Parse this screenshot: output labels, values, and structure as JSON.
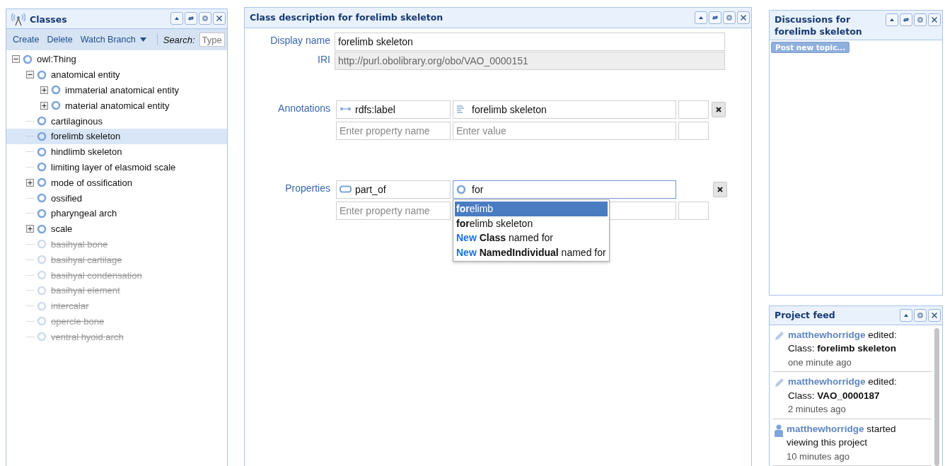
{
  "classes_panel": {
    "title": "Classes",
    "toolbar": {
      "actions": [
        "Create",
        "Delete",
        "Watch Branch"
      ],
      "search_label": "Search:",
      "search_placeholder": "Type"
    },
    "tree": [
      {
        "label": "owl:Thing",
        "expanded": true,
        "selected": false,
        "deprecated": false,
        "children": [
          {
            "label": "anatomical entity",
            "expanded": true,
            "selected": false,
            "deprecated": false,
            "children": [
              {
                "label": "immaterial anatomical entity",
                "expanded": false,
                "selected": false,
                "deprecated": false
              },
              {
                "label": "material anatomical entity",
                "expanded": false,
                "selected": false,
                "deprecated": false
              }
            ]
          },
          {
            "label": "cartilaginous",
            "selected": false,
            "deprecated": false
          },
          {
            "label": "forelimb skeleton",
            "selected": true,
            "deprecated": false
          },
          {
            "label": "hindlimb skeleton",
            "selected": false,
            "deprecated": false
          },
          {
            "label": "limiting layer of elasmoid scale",
            "selected": false,
            "deprecated": false
          },
          {
            "label": "mode of ossification",
            "expanded": false,
            "selected": false,
            "deprecated": false
          },
          {
            "label": "ossified",
            "selected": false,
            "deprecated": false
          },
          {
            "label": "pharyngeal arch",
            "selected": false,
            "deprecated": false
          },
          {
            "label": "scale",
            "expanded": false,
            "selected": false,
            "deprecated": false
          },
          {
            "label": "basihyal bone",
            "selected": false,
            "deprecated": true
          },
          {
            "label": "basihyal cartilage",
            "selected": false,
            "deprecated": true
          },
          {
            "label": "basihyal condensation",
            "selected": false,
            "deprecated": true
          },
          {
            "label": "basihyal element",
            "selected": false,
            "deprecated": true
          },
          {
            "label": "intercalar",
            "selected": false,
            "deprecated": true
          },
          {
            "label": "opercle bone",
            "selected": false,
            "deprecated": true
          },
          {
            "label": "ventral hyoid arch",
            "selected": false,
            "deprecated": true
          }
        ]
      }
    ]
  },
  "description_panel": {
    "title": "Class description for forelimb skeleton",
    "display_name": {
      "label": "Display name",
      "value": "forelimb skeleton"
    },
    "iri": {
      "label": "IRI",
      "value": "http://purl.obolibrary.org/obo/VAO_0000151"
    },
    "annotations": {
      "label": "Annotations",
      "rows": [
        {
          "property": {
            "kind": "annotation_property",
            "value": "rdfs:label"
          },
          "value": {
            "kind": "literal",
            "value": "forelimb skeleton"
          },
          "removable": true
        },
        {
          "property": {
            "placeholder": "Enter property name"
          },
          "value": {
            "placeholder": "Enter value"
          },
          "removable": false
        }
      ]
    },
    "properties": {
      "label": "Properties",
      "rows": [
        {
          "property": {
            "kind": "object_property",
            "value": "part_of"
          },
          "value": {
            "kind": "class",
            "value": "for",
            "focused": true
          },
          "removable": true
        },
        {
          "property": {
            "placeholder": "Enter property name"
          },
          "value": {},
          "removable": false
        }
      ],
      "suggestions": [
        {
          "kind": "match",
          "text": "**for**elimb",
          "selected": true
        },
        {
          "kind": "match",
          "text": "**for**elimb skeleton",
          "selected": false
        },
        {
          "kind": "new",
          "prefix": "New",
          "text": "**Class** named for",
          "selected": false
        },
        {
          "kind": "new",
          "prefix": "New",
          "text": "**NamedIndividual** named for",
          "selected": false
        }
      ]
    }
  },
  "discussions_panel": {
    "title": "Discussions for forelimb skeleton",
    "button": "Post new topic..."
  },
  "feed_panel": {
    "title": "Project feed",
    "items": [
      {
        "kind": "edit",
        "user": "matthewhorridge",
        "action": "edited:",
        "detail": "Class: **forelimb skeleton**",
        "time": "one minute ago"
      },
      {
        "kind": "edit",
        "user": "matthewhorridge",
        "action": "edited:",
        "detail": "Class: **VAO_0000187**",
        "time": "2 minutes ago"
      },
      {
        "kind": "view",
        "user": "matthewhorridge",
        "action": "started viewing this project",
        "time": "10 minutes ago"
      }
    ]
  }
}
